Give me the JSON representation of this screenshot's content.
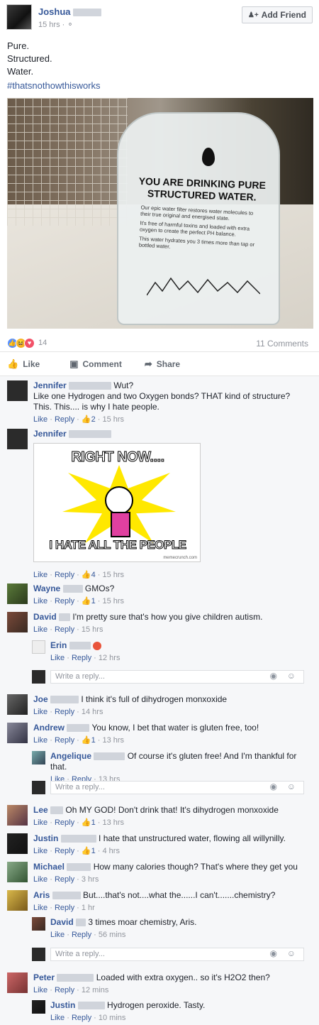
{
  "post": {
    "author": "Joshua",
    "time": "15 hrs · ",
    "add_friend": "Add Friend",
    "text_lines": [
      "Pure.",
      "Structured.",
      "Water."
    ],
    "hashtag": "#thatsnothowthisworks",
    "reaction_count": "14",
    "comment_count": "11 Comments",
    "actions": {
      "like": "Like",
      "comment": "Comment",
      "share": "Share"
    }
  },
  "image": {
    "bottle_title": "YOU ARE DRINKING PURE STRUCTURED WATER.",
    "bottle_p1": "Our epic water filter restores water molecules to their true original and energised state.",
    "bottle_p2": "It's free of harmful toxins and loaded with extra oxygen to create the perfect PH balance.",
    "bottle_p3": "This water hydrates you 3 times more than tap or bottled water."
  },
  "meme": {
    "top": "RIGHT NOW....",
    "bottom": "I HATE ALL THE PEOPLE",
    "watermark": "memecrunch.com"
  },
  "labels": {
    "like": "Like",
    "reply": "Reply",
    "write_reply": "Write a reply..."
  },
  "comments": [
    {
      "name": "Jennifer",
      "text": "Wut?",
      "text2": "Like one Hydrogen and two Oxygen bonds? THAT kind of structure?",
      "text3": "This. This.... is why I hate people.",
      "likes": "2",
      "time": "15 hrs"
    },
    {
      "name": "Jennifer",
      "likes": "4",
      "time": "15 hrs"
    },
    {
      "name": "Wayne",
      "text": "GMOs?",
      "likes": "1",
      "time": "15 hrs"
    },
    {
      "name": "David",
      "text": "I'm pretty sure that's how you give children autism.",
      "time": "15 hrs"
    },
    {
      "name": "Erin",
      "time": "12 hrs"
    },
    {
      "name": "Joe",
      "text": "I think it's full of dihydrogen monxoxide",
      "time": "14 hrs"
    },
    {
      "name": "Andrew",
      "text": "You know, I bet that water is gluten free, too!",
      "likes": "1",
      "time": "13 hrs"
    },
    {
      "name": "Angelique",
      "text": "Of course it's gluten free! And I'm thankful for that.",
      "time": "13 hrs"
    },
    {
      "name": "Lee",
      "text": "Oh MY GOD! Don't drink that! It's dihydrogen monxoxide",
      "likes": "1",
      "time": "13 hrs"
    },
    {
      "name": "Justin",
      "text": "I hate that unstructured water, flowing all willynilly.",
      "likes": "1",
      "time": "4 hrs"
    },
    {
      "name": "Michael",
      "text": "How many calories though? That's where they get you",
      "time": "3 hrs"
    },
    {
      "name": "Aris",
      "text": "But....that's not....what the......I can't.......chemistry?",
      "time": "1 hr"
    },
    {
      "name": "David",
      "text": "3 times moar chemistry, Aris.",
      "time": "56 mins"
    },
    {
      "name": "Peter",
      "text": "Loaded with extra oxygen.. so it's H2O2 then?",
      "time": "12 mins"
    },
    {
      "name": "Justin",
      "text": "Hydrogen peroxide. Tasty.",
      "time": "10 mins"
    }
  ]
}
